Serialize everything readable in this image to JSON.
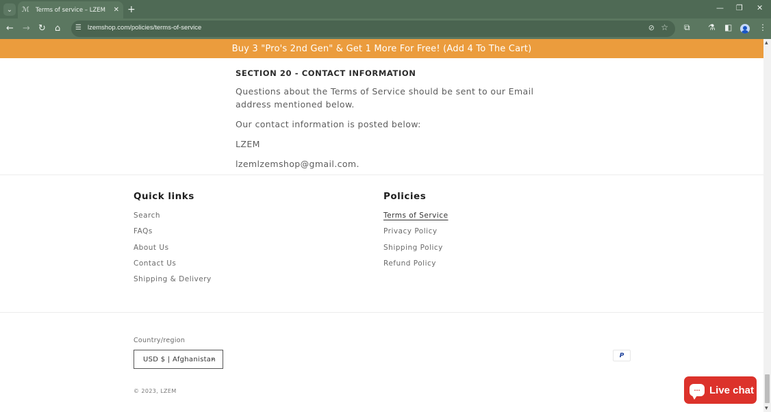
{
  "browser": {
    "tab_title": "Terms of service – LZEM",
    "url": "lzemshop.com/policies/terms-of-service",
    "icons": {
      "tab_search": "chevron-down-icon",
      "favicon": "lzem-logo-icon",
      "close": "close-icon",
      "new_tab": "plus-icon",
      "back": "arrow-left-icon",
      "forward": "arrow-right-icon",
      "reload": "reload-icon",
      "home": "home-icon",
      "site_info": "tune-icon",
      "eye": "eye-off-icon",
      "star": "star-icon",
      "extensions": "puzzle-icon",
      "labs": "flask-icon",
      "sidepanel": "side-panel-icon",
      "profile": "avatar-icon",
      "menu": "more-vert-icon"
    }
  },
  "announcement": {
    "text": "Buy 3 \"Pro's 2nd Gen\" & Get 1 More For Free! (Add 4 To The Cart)",
    "color": "#eb9c3d"
  },
  "policy": {
    "heading": "SECTION 20 - CONTACT INFORMATION",
    "paragraphs": [
      "Questions about the Terms of Service should be sent to our Email address mentioned below.",
      "Our contact information is posted below:",
      "LZEM",
      "lzemlzemshop@gmail.com."
    ]
  },
  "footer": {
    "quick_links": {
      "heading": "Quick links",
      "items": [
        "Search",
        "FAQs",
        "About Us",
        "Contact Us",
        "Shipping & Delivery"
      ]
    },
    "policies": {
      "heading": "Policies",
      "items": [
        "Terms of Service",
        "Privacy Policy",
        "Shipping Policy",
        "Refund Policy"
      ],
      "active": "Terms of Service"
    },
    "country_label": "Country/region",
    "country_value": "USD $ | Afghanistan",
    "copyright": "© 2023, LZEM",
    "payment": "PayPal"
  },
  "livechat": {
    "label": "Live chat",
    "color": "#dc322b"
  }
}
